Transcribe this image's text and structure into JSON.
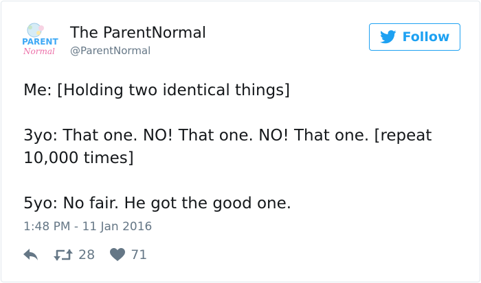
{
  "author": {
    "name": "The ParentNormal",
    "handle": "@ParentNormal",
    "avatar_text": [
      "PARENT",
      "Normal"
    ]
  },
  "follow_button": {
    "label": "Follow",
    "icon": "twitter-bird-icon"
  },
  "tweet": {
    "lines": [
      "Me: [Holding two identical things]",
      "",
      "3yo: That one. NO! That one. NO! That one. [repeat",
      "10,000 times]",
      "",
      "5yo: No fair. He got the good one."
    ]
  },
  "timestamp": "1:48 PM - 11 Jan 2016",
  "actions": {
    "reply_icon": "reply-icon",
    "retweet_icon": "retweet-icon",
    "retweet_count": "28",
    "like_icon": "heart-icon",
    "like_count": "71"
  },
  "colors": {
    "accent": "#1da1f2",
    "text": "#14171a",
    "muted": "#657786",
    "border": "#e1e8ed"
  }
}
